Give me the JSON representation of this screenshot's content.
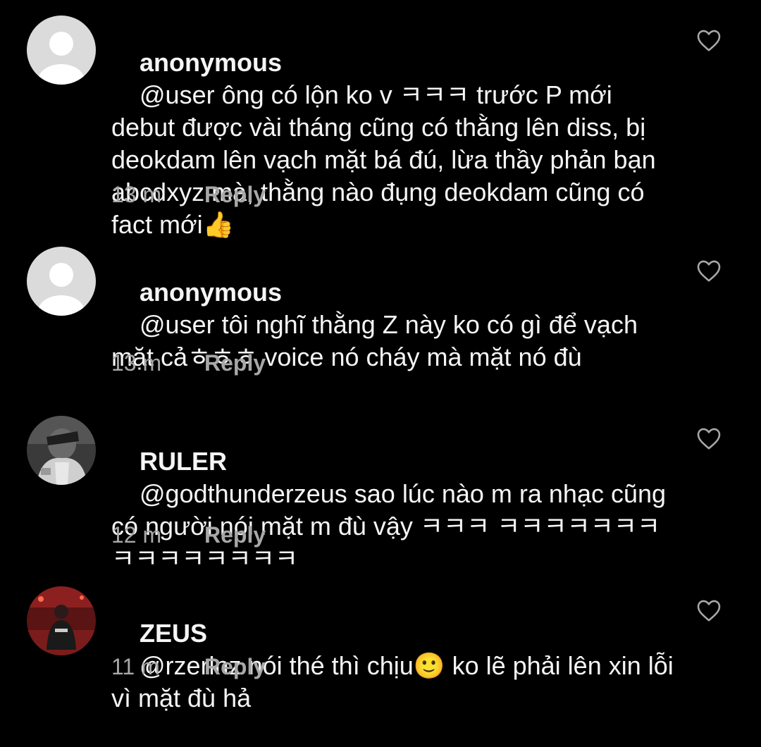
{
  "comments": [
    {
      "username": "anonymous",
      "text": "@user ông có lộn ko v ㅋㅋㅋ trước P mới debut được vài tháng cũng có thằng lên diss, bị deokdam lên vạch mặt bá đú, lừa thầy phản bạn abcdxyz mà, thằng nào đụng deokdam cũng có fact mới👍",
      "time": "13 m",
      "reply": "Reply",
      "avatar": "default-avatar-icon"
    },
    {
      "username": "anonymous",
      "text": "@user tôi nghĩ thằng Z này ko có gì để vạch mặt cảㅎㅎㅎ voice nó cháy mà mặt nó đù",
      "time": "13 m",
      "reply": "Reply",
      "avatar": "default-avatar-icon"
    },
    {
      "username": "RULER",
      "text": "@godthunderzeus sao lúc nào m ra nhạc cũng có người nói mặt m đù vậy ㅋㅋㅋ ㅋㅋㅋㅋㅋㅋㅋㅋㅋㅋㅋㅋㅋㅋㅋ",
      "time": "12 m",
      "reply": "Reply",
      "avatar": "ruler-photo-avatar"
    },
    {
      "username": "ZEUS",
      "text": "@rzerlnz nói thé thì chịu🙂 ko lẽ phải lên xin lỗi vì mặt đù hả",
      "time": "11 m",
      "reply": "Reply",
      "avatar": "zeus-photo-avatar"
    }
  ],
  "colors": {
    "background": "#000000",
    "text": "#f5f5f5",
    "meta": "#a8a8a8",
    "icon": "#a8a8a8",
    "default_avatar_bg": "#dbdbdb"
  }
}
